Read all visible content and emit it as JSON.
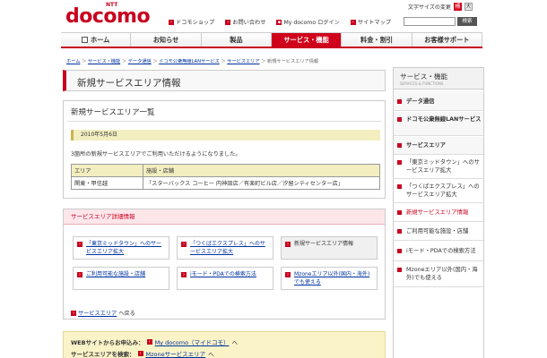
{
  "header": {
    "logo_ntt": "NTT",
    "logo": "docomo",
    "fontsize_label": "文字サイズの変更",
    "fontsize_buttons": [
      "標",
      "大"
    ],
    "toplinks": [
      "ドコモショップ",
      "お問い合わせ",
      "My docomo ログイン",
      "サイトマップ"
    ],
    "search_button": "検索"
  },
  "nav": {
    "items": [
      "ホーム",
      "お知らせ",
      "製品",
      "サービス・機能",
      "料金・割引",
      "お客様サポート"
    ]
  },
  "breadcrumb": {
    "items": [
      "ホーム",
      "サービス・機能",
      "データ通信",
      "ドコモ公衆無線LANサービス",
      "サービスエリア"
    ],
    "current": "新規サービスエリア情報"
  },
  "page": {
    "title": "新規サービスエリア情報"
  },
  "list_section": {
    "heading": "新規サービスエリア一覧",
    "date": "2010年5月6日",
    "description": "3箇所の新規サービスエリアでご利用いただけるようになりました。",
    "table": {
      "headers": [
        "エリア",
        "施設・店舗"
      ],
      "rows": [
        [
          "関東・甲信越",
          "「スターバックス コーヒー 内神田店／有楽町ビル店／汐留シティセンター店」"
        ]
      ]
    }
  },
  "detail_section": {
    "heading": "サービスエリア詳細情報",
    "cards": [
      {
        "label": "「東京ミッドタウン」へのサービスエリア拡大",
        "link": true
      },
      {
        "label": "「つくばエクスプレス」へのサービスエリア拡大",
        "link": true
      },
      {
        "label": "新規サービスエリア情報",
        "link": false
      },
      {
        "label": "ご利用可能な施設・店舗",
        "link": true
      },
      {
        "label": "iモード・PDAでの検索方法",
        "link": true
      },
      {
        "label": "Mzoneエリア以外(国内・海外)でも使える",
        "link": true
      }
    ],
    "back_link": "サービスエリア",
    "back_suffix": "へ戻る"
  },
  "bottom_section": {
    "rows": [
      {
        "label": "WEBサイトからお申込み：",
        "link": "My docomo（マイドコモ）",
        "suffix": "へ"
      },
      {
        "label": "サービスエリアを検索：",
        "link": "Mzoneサービスエリア",
        "suffix": "へ"
      }
    ]
  },
  "sidebar": {
    "title": "サービス・機能",
    "subtitle": "SERVICES & FUNCTIONS",
    "items": [
      {
        "label": "データ通信",
        "type": "cat"
      },
      {
        "label": "ドコモ公衆無線LANサービス",
        "type": "cat"
      },
      {
        "label": "サービスエリア",
        "type": "cat"
      },
      {
        "label": "「東京ミッドタウン」へのサービスエリア拡大",
        "type": "sub"
      },
      {
        "label": "「つくばエクスプレス」へのサービスエリア拡大",
        "type": "sub"
      },
      {
        "label": "新規サービスエリア情報",
        "type": "active"
      },
      {
        "label": "ご利用可能な施設・店舗",
        "type": "sub"
      },
      {
        "label": "iモード・PDAでの検索方法",
        "type": "sub"
      },
      {
        "label": "Mzoneエリア以外(国内・海外)でも使える",
        "type": "sub"
      }
    ]
  },
  "colors": {
    "brand": "#c8001e",
    "link": "#0033a0",
    "highlight": "#f3eec0"
  }
}
